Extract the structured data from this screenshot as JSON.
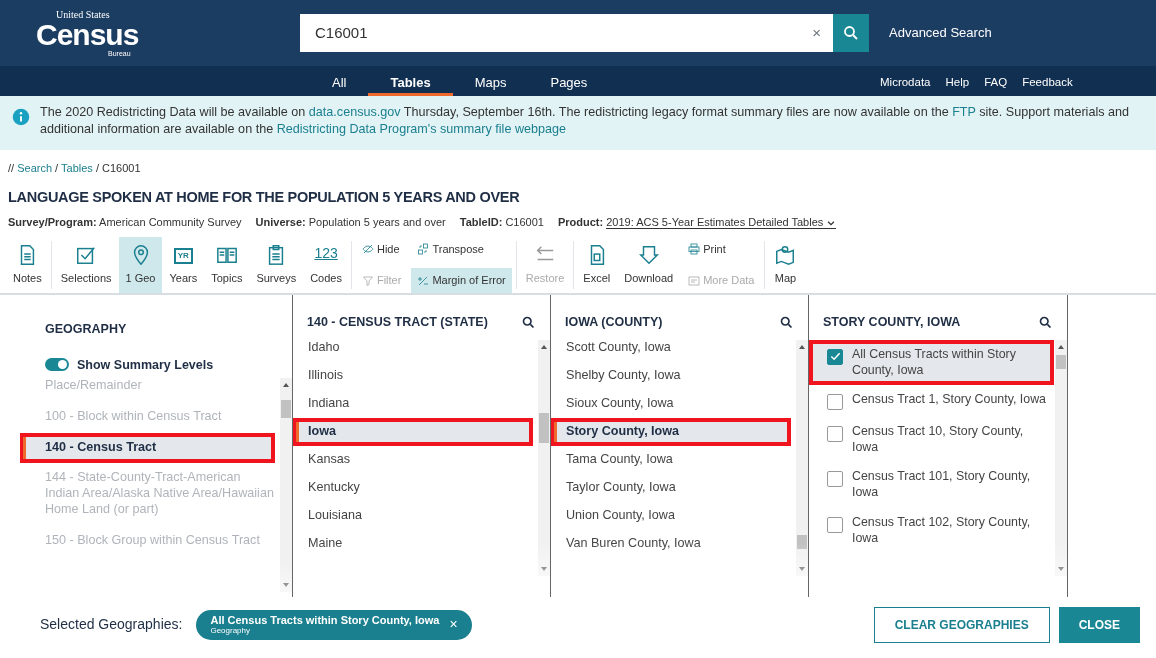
{
  "header": {
    "logo": {
      "top": "United States",
      "main": "Census",
      "bottom": "Bureau"
    },
    "search": {
      "value": "C16001",
      "clear": "×"
    },
    "advanced_search": "Advanced Search"
  },
  "nav": {
    "tabs": [
      {
        "label": "All",
        "selected": false
      },
      {
        "label": "Tables",
        "selected": true
      },
      {
        "label": "Maps",
        "selected": false
      },
      {
        "label": "Pages",
        "selected": false
      }
    ],
    "links": [
      "Microdata",
      "Help",
      "FAQ",
      "Feedback"
    ]
  },
  "banner": {
    "parts": [
      {
        "kind": "text",
        "text": "The 2020 Redistricting Data will be available on "
      },
      {
        "kind": "link",
        "text": "data.census.gov"
      },
      {
        "kind": "text",
        "text": " Thursday, September 16th. The redistricting legacy format summary files are now available on the "
      },
      {
        "kind": "link",
        "text": "FTP"
      },
      {
        "kind": "text",
        "text": " site. Support materials and additional information are available on the "
      },
      {
        "kind": "link",
        "text": "Redistricting Data Program's summary file webpage"
      }
    ]
  },
  "breadcrumb": [
    {
      "kind": "text",
      "text": "//"
    },
    {
      "kind": "link",
      "text": "Search"
    },
    {
      "kind": "text",
      "text": "/"
    },
    {
      "kind": "link",
      "text": "Tables"
    },
    {
      "kind": "text",
      "text": "/ C16001"
    }
  ],
  "table_title": "LANGUAGE SPOKEN AT HOME FOR THE POPULATION 5 YEARS AND OVER",
  "meta": [
    {
      "label": "Survey/Program:",
      "value": "American Community Survey",
      "kind": "text"
    },
    {
      "label": "Universe:",
      "value": "Population 5 years and over",
      "kind": "text"
    },
    {
      "label": "TableID:",
      "value": "C16001",
      "kind": "text"
    },
    {
      "label": "Product:",
      "value": "2019: ACS 5-Year Estimates Detailed Tables",
      "kind": "dropdown"
    }
  ],
  "toolbar": [
    {
      "kind": "button",
      "label": "Notes",
      "selected": false,
      "disabled": false
    },
    {
      "kind": "button",
      "label": "Selections",
      "selected": false,
      "disabled": false
    },
    {
      "kind": "button",
      "label": "1 Geo",
      "selected": true,
      "disabled": false
    },
    {
      "kind": "button",
      "label": "Years",
      "icon_text": "YR",
      "selected": false,
      "disabled": false
    },
    {
      "kind": "button",
      "label": "Topics",
      "selected": false,
      "disabled": false
    },
    {
      "kind": "button",
      "label": "Surveys",
      "selected": false,
      "disabled": false
    },
    {
      "kind": "button",
      "label": "Codes",
      "icon_text": "123",
      "selected": false,
      "disabled": false
    },
    {
      "kind": "stack",
      "items": [
        {
          "label": "Hide",
          "selected": false,
          "disabled": false
        },
        {
          "label": "Filter",
          "selected": false,
          "disabled": true
        }
      ]
    },
    {
      "kind": "stack",
      "items": [
        {
          "label": "Transpose",
          "selected": false,
          "disabled": false
        },
        {
          "label": "Margin of Error",
          "selected": true,
          "disabled": false
        }
      ]
    },
    {
      "kind": "button",
      "label": "Restore",
      "selected": false,
      "disabled": true
    },
    {
      "kind": "button",
      "label": "Excel",
      "selected": false,
      "disabled": false
    },
    {
      "kind": "button",
      "label": "Download",
      "selected": false,
      "disabled": false
    },
    {
      "kind": "stack",
      "items": [
        {
          "label": "Print",
          "selected": false,
          "disabled": false
        },
        {
          "label": "More Data",
          "selected": false,
          "disabled": true
        }
      ]
    },
    {
      "kind": "button",
      "label": "Map",
      "selected": false,
      "disabled": false
    }
  ],
  "geography": {
    "title": "GEOGRAPHY",
    "toggle": {
      "label": "Show Summary Levels",
      "on": true
    },
    "levels": [
      {
        "label": "Place/Remainder",
        "selected": false,
        "highlighted": false
      },
      {
        "label": "100 - Block within Census Tract",
        "selected": false,
        "highlighted": false
      },
      {
        "label": "140 - Census Tract",
        "selected": true,
        "highlighted": true
      },
      {
        "label": "144 - State-County-Tract-American Indian Area/Alaska Native Area/Hawaiian Home Land (or part)",
        "selected": false,
        "highlighted": false
      },
      {
        "label": "150 - Block Group within Census Tract",
        "selected": false,
        "highlighted": false
      }
    ]
  },
  "columns": [
    {
      "title": "140 - CENSUS TRACT (STATE)",
      "kind": "plain",
      "items": [
        {
          "label": "Idaho",
          "selected": false,
          "highlighted": false
        },
        {
          "label": "Illinois",
          "selected": false,
          "highlighted": false
        },
        {
          "label": "Indiana",
          "selected": false,
          "highlighted": false
        },
        {
          "label": "Iowa",
          "selected": true,
          "highlighted": true
        },
        {
          "label": "Kansas",
          "selected": false,
          "highlighted": false
        },
        {
          "label": "Kentucky",
          "selected": false,
          "highlighted": false
        },
        {
          "label": "Louisiana",
          "selected": false,
          "highlighted": false
        },
        {
          "label": "Maine",
          "selected": false,
          "highlighted": false
        }
      ]
    },
    {
      "title": "IOWA (COUNTY)",
      "kind": "plain",
      "items": [
        {
          "label": "Scott County, Iowa",
          "selected": false,
          "highlighted": false
        },
        {
          "label": "Shelby County, Iowa",
          "selected": false,
          "highlighted": false
        },
        {
          "label": "Sioux County, Iowa",
          "selected": false,
          "highlighted": false
        },
        {
          "label": "Story County, Iowa",
          "selected": true,
          "highlighted": true
        },
        {
          "label": "Tama County, Iowa",
          "selected": false,
          "highlighted": false
        },
        {
          "label": "Taylor County, Iowa",
          "selected": false,
          "highlighted": false
        },
        {
          "label": "Union County, Iowa",
          "selected": false,
          "highlighted": false
        },
        {
          "label": "Van Buren County, Iowa",
          "selected": false,
          "highlighted": false
        }
      ]
    },
    {
      "title": "STORY COUNTY, IOWA",
      "kind": "checkbox",
      "items": [
        {
          "label": "All Census Tracts within Story County, Iowa",
          "checked": true,
          "highlighted": true
        },
        {
          "label": "Census Tract 1, Story County, Iowa",
          "checked": false,
          "highlighted": false
        },
        {
          "label": "Census Tract 10, Story County, Iowa",
          "checked": false,
          "highlighted": false
        },
        {
          "label": "Census Tract 101, Story County, Iowa",
          "checked": false,
          "highlighted": false
        },
        {
          "label": "Census Tract 102, Story County, Iowa",
          "checked": false,
          "highlighted": false
        }
      ]
    }
  ],
  "footer": {
    "label": "Selected Geographies:",
    "chips": [
      {
        "label": "All Census Tracts within Story County, Iowa",
        "sublabel": "Geography",
        "remove": "×"
      }
    ],
    "buttons": [
      {
        "label": "CLEAR GEOGRAPHIES",
        "kind": "outline"
      },
      {
        "label": "CLOSE",
        "kind": "solid"
      }
    ]
  }
}
